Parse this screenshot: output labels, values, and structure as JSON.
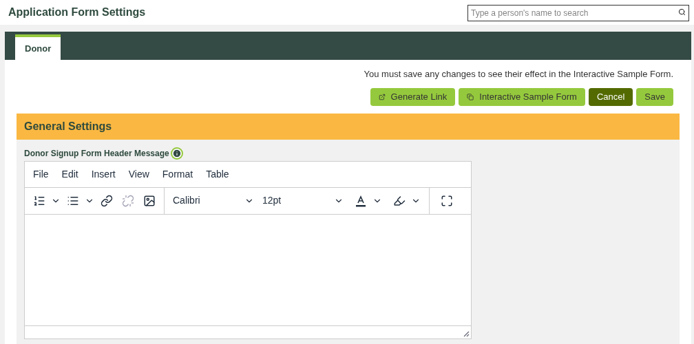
{
  "header": {
    "title": "Application Form Settings",
    "search": {
      "placeholder": "Type a person's name to search"
    }
  },
  "tabs": [
    {
      "label": "Donor",
      "selected": true
    }
  ],
  "notice": "You must save any changes to see their effect in the Interactive Sample Form.",
  "buttons": [
    {
      "label": "Generate Link",
      "kind": "link"
    },
    {
      "label": "Interactive Sample Form",
      "kind": "window"
    },
    {
      "label": "Cancel",
      "kind": "cancel"
    },
    {
      "label": "Save",
      "kind": "save"
    }
  ],
  "section": {
    "title": "General Settings",
    "field_label": "Donor Signup Form Header Message",
    "editor": {
      "menu": [
        "File",
        "Edit",
        "Insert",
        "View",
        "Format",
        "Table"
      ],
      "font": "Calibri",
      "size": "12pt"
    }
  }
}
